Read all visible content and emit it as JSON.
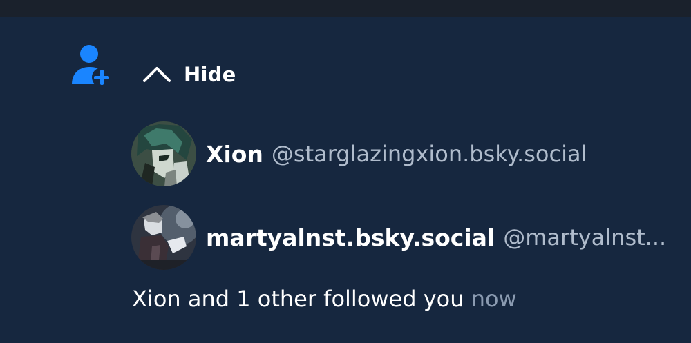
{
  "notification": {
    "icon": "person-add-icon",
    "accent_color": "#1a85ff",
    "toggle": {
      "icon": "chevron-up-icon",
      "label": "Hide"
    },
    "users": [
      {
        "display_name": "Xion",
        "handle": "@starglazingxion.bsky.social",
        "avatar": "avatar-image"
      },
      {
        "display_name": "martyalnst.bsky.social",
        "handle": "@martyalnst...",
        "avatar": "avatar-image"
      }
    ],
    "summary": {
      "text": "Xion and 1 other followed you",
      "time": "now"
    }
  }
}
